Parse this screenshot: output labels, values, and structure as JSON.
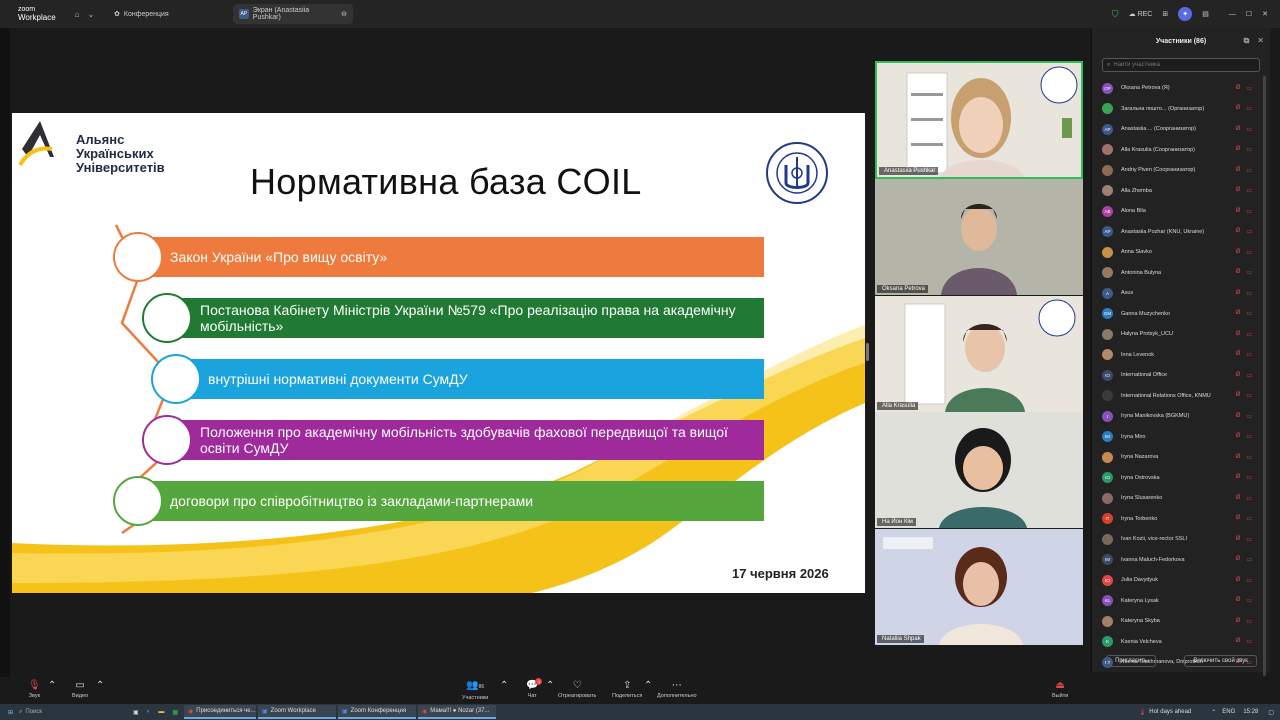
{
  "topbar": {
    "logo_line1": "zoom",
    "logo_line2": "Workplace",
    "tab_conference": "Конференция",
    "tab_screen": "Экран (Anastasiia Pushkar)",
    "tab_screen_avatar": "AP",
    "rec_label": "REC"
  },
  "slide": {
    "brand_line1": "Альянс",
    "brand_line2": "Українських",
    "brand_line3": "Університетів",
    "title": "Нормативна база COIL",
    "date": "17 червня 2026",
    "items": [
      {
        "text": "Закон України «Про вищу освіту»",
        "color": "#ee7a3d"
      },
      {
        "text": "Постанова Кабінету Міністрів України №579 «Про реалізацію права на академічну мобільність»",
        "color": "#217a34"
      },
      {
        "text": "внутрішні нормативні документи СумДУ",
        "color": "#1aa3dd"
      },
      {
        "text": "Положення про академічну мобільність здобувачів фахової передвищої та вищої освіти СумДУ",
        "color": "#9e2a9c"
      },
      {
        "text": "договори про співробітництво із закладами-партнерами",
        "color": "#54a63d"
      }
    ]
  },
  "videos": [
    {
      "name": "Anastasiia Pushkar"
    },
    {
      "name": "Oksana Petrova"
    },
    {
      "name": "Alla Krasulia"
    },
    {
      "name": "Ha Йон Кім"
    },
    {
      "name": "Nataliia Shpak"
    }
  ],
  "panel": {
    "title": "Участники (86)",
    "search_placeholder": "Найти участника",
    "invite": "Пригласить",
    "unmute_all": "Включить свой звук",
    "participants": [
      {
        "initials": "OP",
        "color": "#8a4fbd",
        "name": "Oksana Petrova (Я)"
      },
      {
        "initials": "",
        "color": "#3aa35a",
        "name": "Загальна пошто... (Организатор)"
      },
      {
        "initials": "AP",
        "color": "#3c5a8a",
        "name": "Anastasiia ... (Соорганизатор)"
      },
      {
        "initials": "",
        "color": "#a0736a",
        "name": "Alla Krasulia (Соорганизатор)"
      },
      {
        "initials": "",
        "color": "#8c6b50",
        "name": "Andriy Piven (Соорганизатор)"
      },
      {
        "initials": "",
        "color": "#a08070",
        "name": "Alla Zhemba"
      },
      {
        "initials": "AB",
        "color": "#b23ea8",
        "name": "Alona Bila"
      },
      {
        "initials": "AP",
        "color": "#3c5a8a",
        "name": "Anastasiia Pozhar (KNU, Ukraine)"
      },
      {
        "initials": "",
        "color": "#c89048",
        "name": "Anna Slavko"
      },
      {
        "initials": "",
        "color": "#9a7860",
        "name": "Antonina Bulyna"
      },
      {
        "initials": "A",
        "color": "#3c5a8a",
        "name": "Asus"
      },
      {
        "initials": "GM",
        "color": "#2a7dc1",
        "name": "Ganna Muzychenko"
      },
      {
        "initials": "",
        "color": "#8a7a68",
        "name": "Halyna Protsyk_UCU"
      },
      {
        "initials": "",
        "color": "#b08a6a",
        "name": "Inna Levenok"
      },
      {
        "initials": "IO",
        "color": "#3c4a6a",
        "name": "International Office"
      },
      {
        "initials": "",
        "color": "#3a3a3a",
        "name": "International Relations Office, KNMU"
      },
      {
        "initials": "I",
        "color": "#8a4fbd",
        "name": "Iryna Manikovska (BGKMU)"
      },
      {
        "initials": "IM",
        "color": "#2a7dc1",
        "name": "Iryna Miro"
      },
      {
        "initials": "",
        "color": "#c88a50",
        "name": "Iryna Nazarova"
      },
      {
        "initials": "IO",
        "color": "#2a9a6a",
        "name": "Iryna Ostrovska"
      },
      {
        "initials": "",
        "color": "#8a6a68",
        "name": "Iryna Slusarenko"
      },
      {
        "initials": "IT",
        "color": "#d8402a",
        "name": "Iryna Torbenko"
      },
      {
        "initials": "",
        "color": "#7a6a5a",
        "name": "Ivan Kozii, vice-rector SSLI"
      },
      {
        "initials": "IM",
        "color": "#3c4a6a",
        "name": "Ivanna Maluch-Fedorkova"
      },
      {
        "initials": "IO",
        "color": "#e04848",
        "name": "Julia Davydyuk"
      },
      {
        "initials": "KL",
        "color": "#8a4fbd",
        "name": "Kateryna Lysak"
      },
      {
        "initials": "",
        "color": "#a08068",
        "name": "Kateryna Skyba"
      },
      {
        "initials": "K",
        "color": "#2a9a6a",
        "name": "Ksenia Velcheva"
      },
      {
        "initials": "KT",
        "color": "#3c5a8a",
        "name": "Ksenia Tsukhmanova, Dniprotech"
      }
    ]
  },
  "toolbar": {
    "audio": "Звук",
    "video": "Видео",
    "participants": "Участники",
    "participants_count": "86",
    "chat": "Чат",
    "chat_badge": "1",
    "react": "Отреагировать",
    "share": "Поделиться",
    "more": "Дополнительно",
    "leave": "Выйти"
  },
  "taskbar": {
    "search": "Поиск",
    "app1": "Присоединиться че...",
    "app2": "Zoom Workplace",
    "app3": "Zoom Конференция",
    "app4": "Мама!!! ● Nozar (37...",
    "weather": "Hot days ahead",
    "lang": "ENG",
    "time": "15:28"
  }
}
